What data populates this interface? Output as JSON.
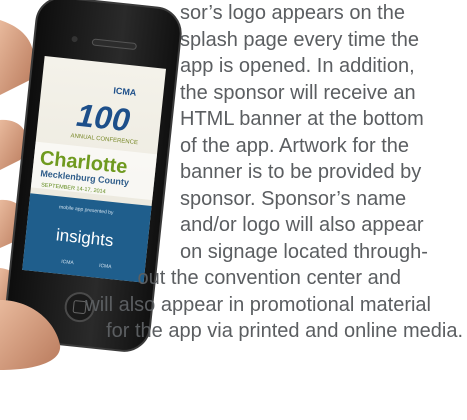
{
  "phone_screen": {
    "badge": "ICMA",
    "anniversary_number": "100",
    "conference_label": "ANNUAL CONFERENCE",
    "city": "Charlotte",
    "county": "Mecklenburg County",
    "dates": "SEPTEMBER 14-17, 2014",
    "presented_by": "mobile app presented by",
    "sponsor": "insights",
    "footer_left": "ICMA",
    "footer_right": "ICMA"
  },
  "text_lines_right": [
    "sor’s logo appears on the",
    "splash page every time the",
    "app is opened. In addition,",
    "the sponsor will receive an",
    "HTML banner at the bottom",
    "of the app. Artwork for the",
    "banner is to be provided by",
    "sponsor. Sponsor’s name",
    "and/or logo will also appear",
    "on signage located through-"
  ],
  "text_lines_full": [
    "out the convention center and",
    "will also appear in promotional material",
    "for the app via printed and online media."
  ]
}
